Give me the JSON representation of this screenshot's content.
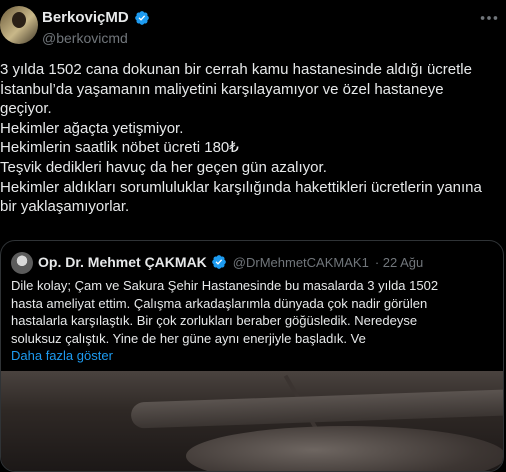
{
  "author": {
    "display_name": "BerkoviçMD",
    "handle": "@berkovicmd"
  },
  "post": {
    "lines": [
      "3 yılda 1502 cana dokunan bir cerrah kamu hastanesinde aldığı ücretle",
      "İstanbul’da yaşamanın  maliyetini karşılayamıyor ve özel hastaneye",
      "geçiyor.",
      "Hekimler ağaçta yetişmiyor.",
      "Hekimlerin saatlik nöbet ücreti 180₺",
      "Teşvik dedikleri havuç da her geçen gün azalıyor.",
      "Hekimler aldıkları sorumluluklar karşılığında hakettikleri ücretlerin yanına",
      "bir yaklaşamıyorlar."
    ]
  },
  "quoted": {
    "display_name": "Op. Dr. Mehmet ÇAKMAK",
    "handle": "@DrMehmetCAKMAK1",
    "date": "· 22 Ağu",
    "lines": [
      "Dile kolay; Çam ve Sakura Şehir Hastanesinde bu masalarda 3 yılda 1502",
      "hasta ameliyat ettim. Çalışma arkadaşlarımla dünyada çok nadir görülen",
      "hastalarla karşılaştık. Bir çok zorlukları beraber göğüsledik. Neredeyse",
      "soluksuz çalıştık. Yine de her güne aynı enerjiyle başladık. Ve"
    ],
    "show_more": "Daha fazla göster"
  },
  "icons": {
    "verified": "verified-badge-icon",
    "more": "more-options-icon"
  },
  "colors": {
    "background": "#000000",
    "text": "#e7e9ea",
    "secondary": "#71767b",
    "accent": "#1d9bf0",
    "border": "#2f3336"
  }
}
